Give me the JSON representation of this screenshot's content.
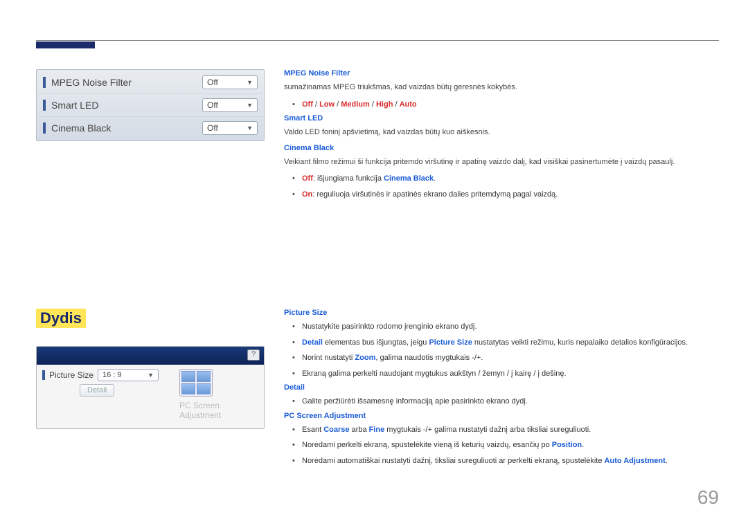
{
  "page_number": "69",
  "menu1": {
    "rows": [
      {
        "label": "MPEG Noise Filter",
        "value": "Off"
      },
      {
        "label": "Smart LED",
        "value": "Off"
      },
      {
        "label": "Cinema Black",
        "value": "Off"
      }
    ]
  },
  "sec1": {
    "mpeg": {
      "title": "MPEG Noise Filter",
      "desc": "sumažinamas MPEG triukšmas, kad vaizdas būtų geresnės kokybės.",
      "opts": [
        "Off",
        "Low",
        "Medium",
        "High",
        "Auto"
      ]
    },
    "smart": {
      "title": "Smart LED",
      "desc": "Valdo LED foninį apšvietimą, kad vaizdas būtų kuo aiškesnis."
    },
    "cinema": {
      "title": "Cinema Black",
      "desc": "Veikiant filmo režimui ši funkcija pritemdo viršutinę ir apatinę vaizdo dalį, kad visiškai pasinertumėte į vaizdų pasaulį.",
      "off_label": "Off",
      "off_text": ": išjungiama funkcija ",
      "off_target": "Cinema Black",
      "off_end": ".",
      "on_label": "On",
      "on_text": ": reguliuoja viršutinės ir apatinės ekrano dalies pritemdymą pagal vaizdą."
    }
  },
  "heading2": "Dydis",
  "menu2": {
    "row_label": "Picture Size",
    "row_value": "16 : 9",
    "detail_btn": "Detail",
    "psa_line1": "PC Screen",
    "psa_line2": "Adjustment",
    "help": "?"
  },
  "sec2": {
    "ps": {
      "title": "Picture Size",
      "b1": "Nustatykite pasirinkto rodomo įrenginio ekrano dydį.",
      "b2_a": "Detail",
      "b2_b": " elementas bus išjungtas, jeigu ",
      "b2_c": "Picture Size",
      "b2_d": " nustatytas veikti režimu, kuris nepalaiko detalios konfigūracijos.",
      "b3_a": "Norint nustatyti ",
      "b3_b": "Zoom",
      "b3_c": ", galima naudotis mygtukais -/+.",
      "b4": "Ekraną galima perkelti naudojant mygtukus aukštyn / žemyn / į kairę / į dešinę."
    },
    "detail": {
      "title": "Detail",
      "b1": "Galite peržiūrėti išsamesnę informaciją apie pasirinkto ekrano dydį."
    },
    "pcsa": {
      "title": "PC Screen Adjustment",
      "b1_a": "Esant ",
      "b1_b": "Coarse",
      "b1_c": " arba ",
      "b1_d": "Fine",
      "b1_e": " mygtukais -/+ galima nustatyti dažnį arba tiksliai sureguliuoti.",
      "b2_a": "Norėdami perkelti ekraną, spustelėkite vieną iš keturių vaizdų, esančių po ",
      "b2_b": "Position",
      "b2_c": ".",
      "b3_a": "Norėdami automatiškai nustatyti dažnį, tiksliai sureguliuoti ar perkelti ekraną, spustelėkite ",
      "b3_b": "Auto Adjustment",
      "b3_c": "."
    }
  }
}
